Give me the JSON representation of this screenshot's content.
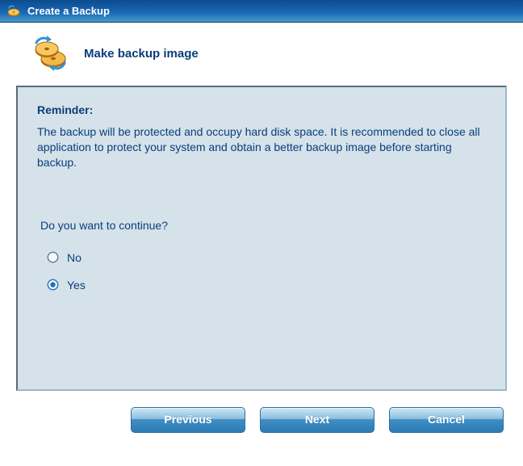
{
  "window": {
    "title": "Create a Backup"
  },
  "header": {
    "title": "Make backup image"
  },
  "panel": {
    "reminder_label": "Reminder:",
    "reminder_body": "The backup will be protected and occupy hard disk space. It is recommended to close all application to protect your system and obtain a better backup image before starting backup.",
    "question": "Do you want to continue?",
    "options": {
      "no": "No",
      "yes": "Yes",
      "selected": "yes"
    }
  },
  "buttons": {
    "previous": "Previous",
    "next": "Next",
    "cancel": "Cancel"
  },
  "colors": {
    "accent": "#0a3e7a",
    "panel_bg": "#d5e2ea"
  }
}
